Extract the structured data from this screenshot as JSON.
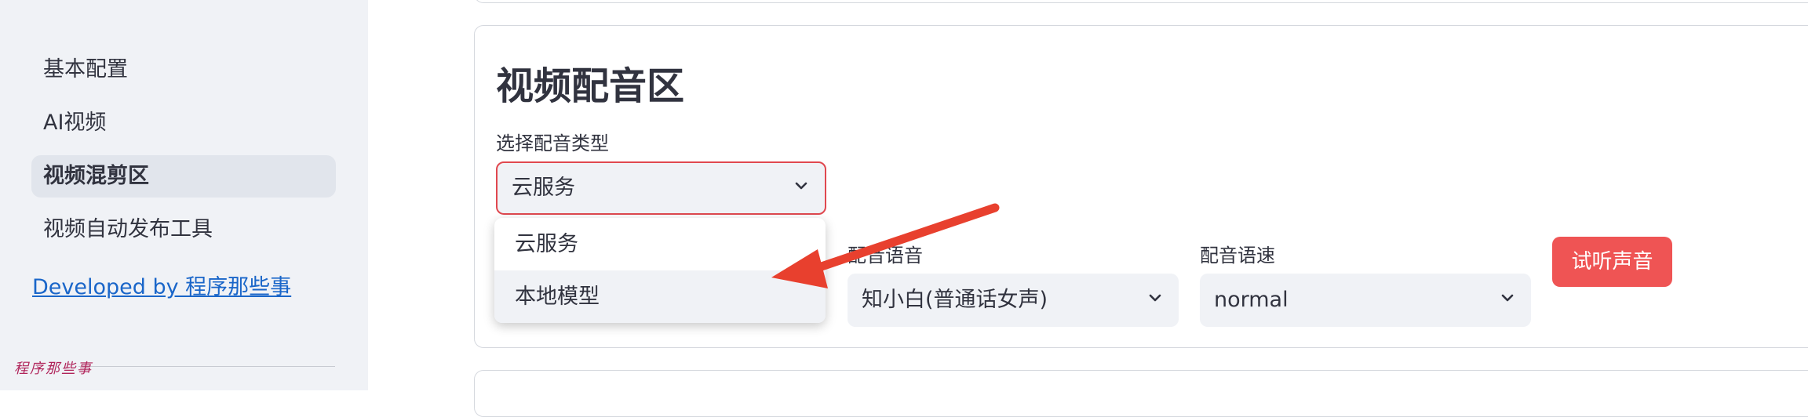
{
  "sidebar": {
    "items": [
      {
        "label": "基本配置"
      },
      {
        "label": "AI视频"
      },
      {
        "label": "视频混剪区"
      },
      {
        "label": "视频自动发布工具"
      }
    ],
    "developer_link": "Developed by 程序那些事",
    "signature": "程序那些事"
  },
  "main": {
    "section_title": "视频配音区",
    "voice_type": {
      "label": "选择配音类型",
      "value": "云服务",
      "options": [
        "云服务",
        "本地模型"
      ],
      "hovered_option": "本地模型"
    },
    "voice_language": {
      "label": "配音语音",
      "value": "知小白(普通话女声)"
    },
    "voice_speed": {
      "label": "配音语速",
      "value": "normal"
    },
    "preview_button": "试听声音"
  },
  "colors": {
    "accent": "#ef5454",
    "annotation_arrow": "#e8402e",
    "link": "#1a66c9",
    "sidebar_bg": "#f0f2f6"
  }
}
